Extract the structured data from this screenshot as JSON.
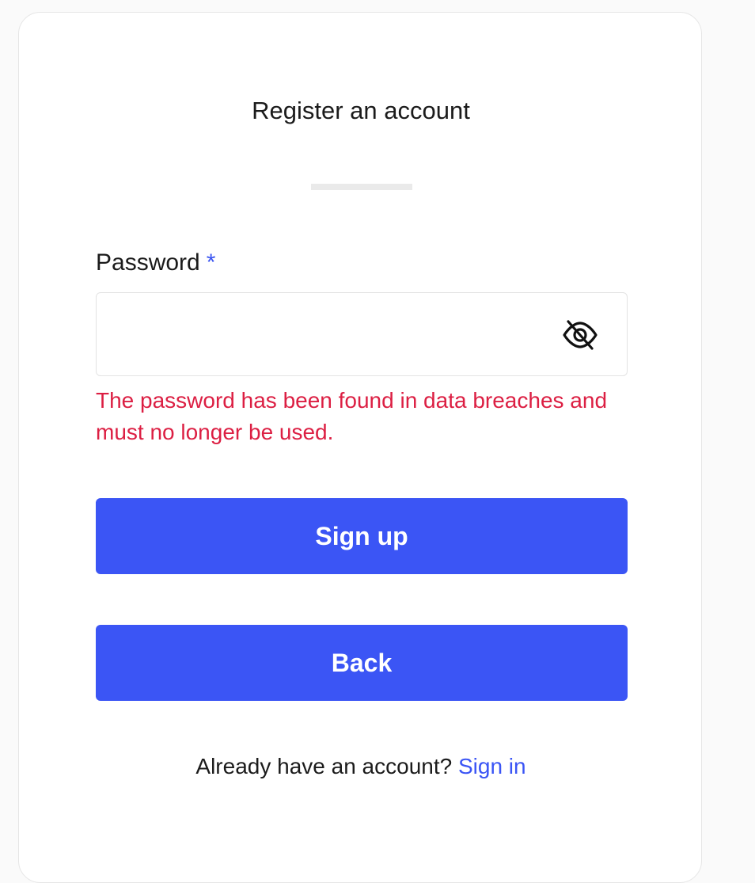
{
  "form": {
    "title": "Register an account",
    "password_label": "Password",
    "required_marker": "*",
    "password_value": "",
    "password_visibility_icon": "eye-off-icon",
    "error_message": "The password has been found in data breaches and must no longer be used.",
    "signup_label": "Sign up",
    "back_label": "Back"
  },
  "footer": {
    "prompt": "Already have an account?",
    "signin_label": "Sign in"
  },
  "colors": {
    "primary": "#3b55f5",
    "error": "#dc1f43",
    "text": "#1b1b1b",
    "card_border": "#e6e6e6",
    "background": "#fafafa"
  }
}
